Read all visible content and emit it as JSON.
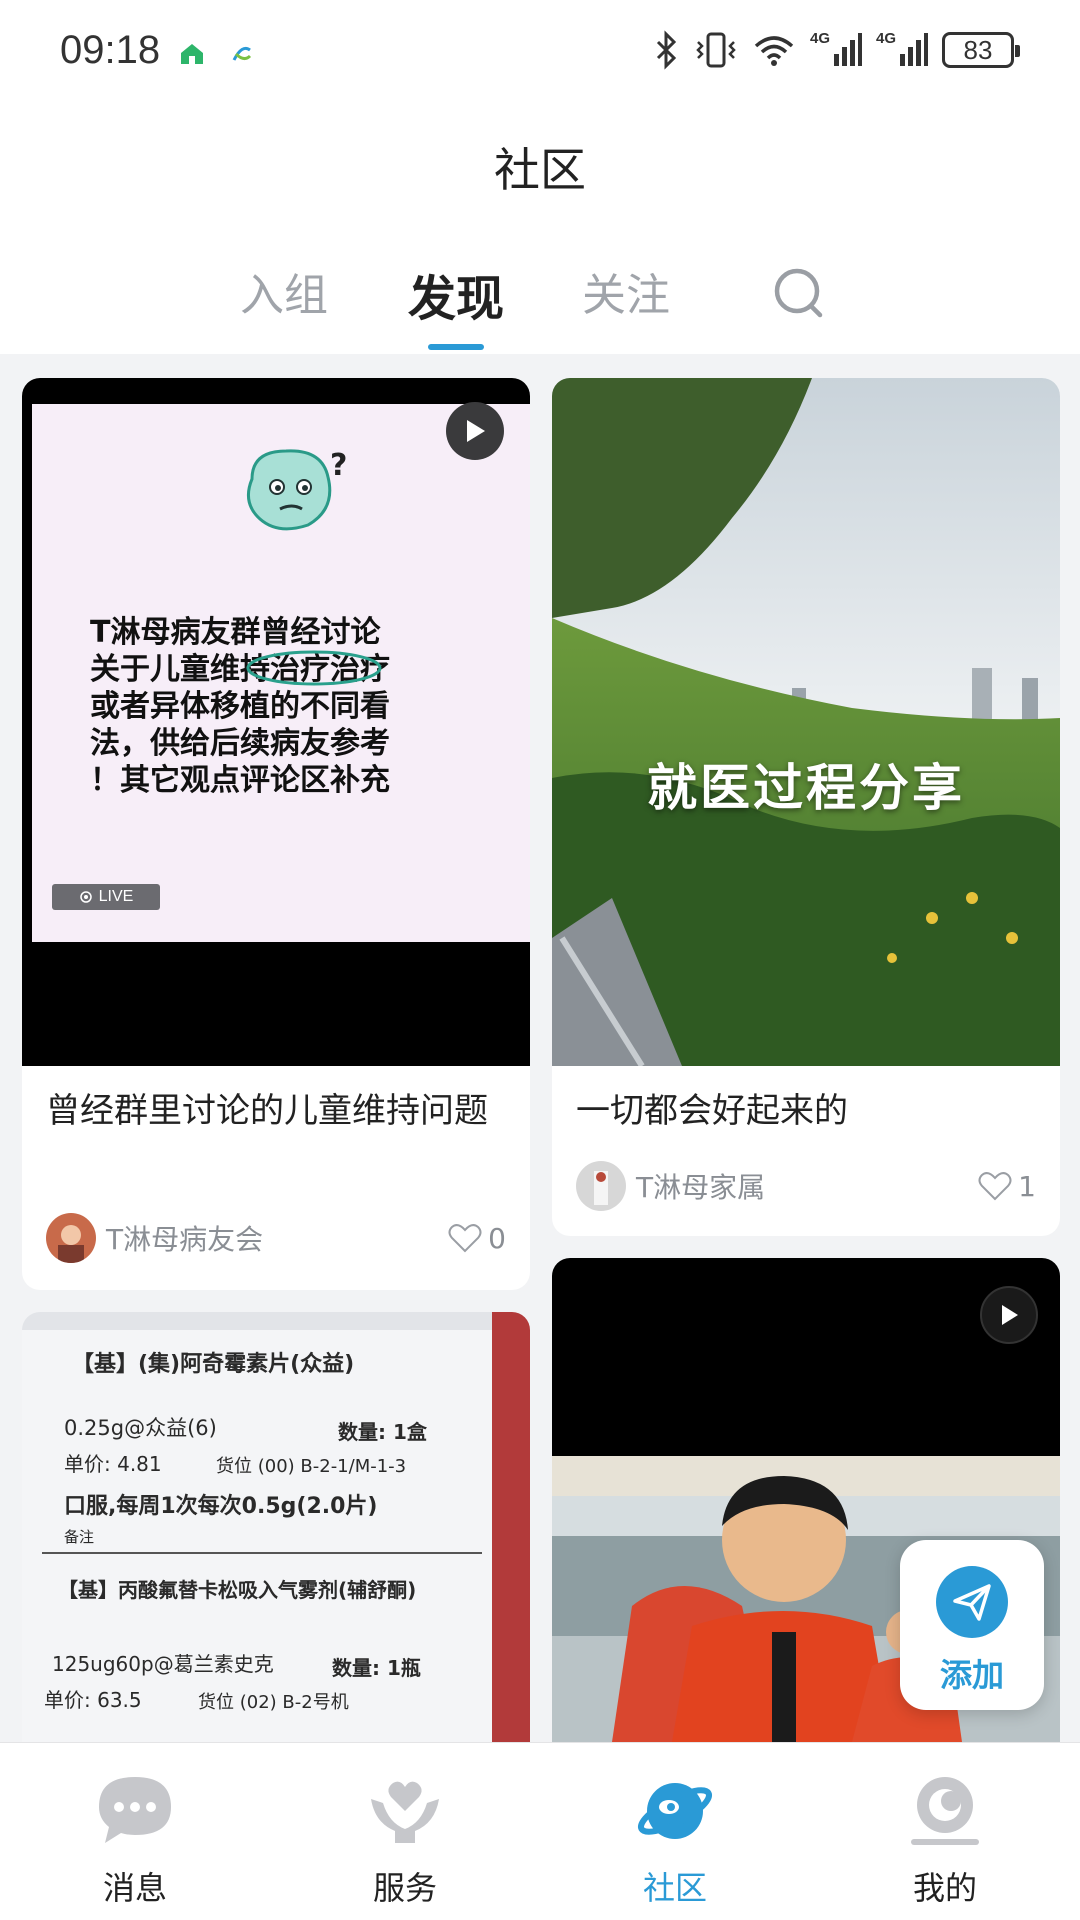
{
  "status_bar": {
    "time": "09:18",
    "signal_1": "4G",
    "signal_2": "4G",
    "battery": "83",
    "icons": [
      "home-badge-icon",
      "mobile-logo-icon",
      "bluetooth-icon",
      "vibrate-icon",
      "wifi-icon",
      "signal-icon",
      "signal-icon",
      "battery-icon"
    ]
  },
  "header": {
    "title": "社区",
    "tabs": [
      {
        "label": "入组",
        "active": false
      },
      {
        "label": "发现",
        "active": true
      },
      {
        "label": "关注",
        "active": false
      }
    ],
    "search_icon": "search-icon"
  },
  "feed": {
    "cards": [
      {
        "title": "曾经群里讨论的儿童维持问题",
        "author": "T淋母病友会",
        "likes": "0",
        "media": {
          "poster_text": "T淋母病友群曾经讨论\n关于儿童维持治疗治疗\n或者异体移植的不同看\n法，供给后续病友参考\n！其它观点评论区补充",
          "live_badge": "LIVE",
          "has_play_icon": true
        }
      },
      {
        "title": "一切都会好起来的",
        "author": "T淋母家属",
        "likes": "1",
        "media": {
          "caption": "就医过程分享"
        }
      },
      {
        "media": {
          "receipt_lines": [
            "【基】(集)阿奇霉素片(众益)",
            "0.25g@众益(6)",
            "数量: 1盒",
            "单价: 4.81",
            "货位 (00) B-2-1/M-1-3",
            "口服,每周1次每次0.5g(2.0片)",
            "备注",
            "【基】丙酸氟替卡松吸入气雾剂(辅舒酮)",
            "125ug60p@葛兰素史克",
            "数量: 1瓶",
            "单价: 63.5",
            "货位 (02) B-2号机"
          ]
        }
      },
      {
        "media": {
          "has_play_icon": true
        }
      }
    ]
  },
  "fab": {
    "label": "添加",
    "icon": "paper-plane-icon"
  },
  "bottom_nav": {
    "items": [
      {
        "label": "消息",
        "icon": "chat-bubble-icon",
        "active": false
      },
      {
        "label": "服务",
        "icon": "heart-hands-icon",
        "active": false
      },
      {
        "label": "社区",
        "icon": "planet-icon",
        "active": true
      },
      {
        "label": "我的",
        "icon": "profile-icon",
        "active": false
      }
    ]
  },
  "colors": {
    "accent": "#2a9ad6",
    "background": "#f2f3f5",
    "muted_text": "#8a8e94"
  }
}
